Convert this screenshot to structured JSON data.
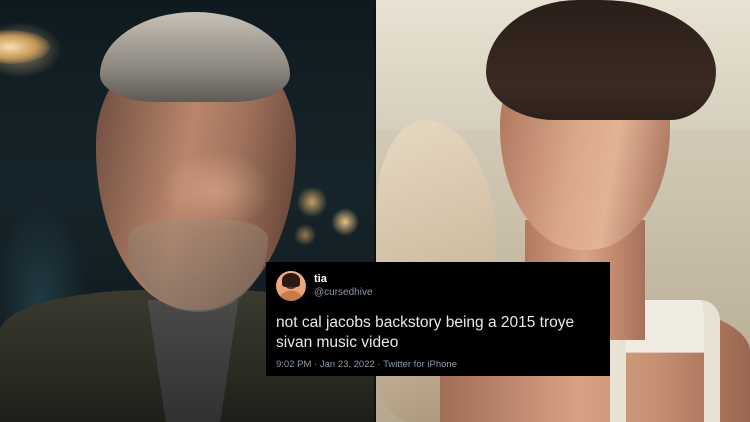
{
  "tweet": {
    "display_name": "tia",
    "handle": "@cursedhive",
    "text": "not cal jacobs backstory being a 2015 troye sivan music video",
    "time": "9:02 PM",
    "separator": "·",
    "date": "Jan 23, 2022",
    "source": "Twitter for iPhone",
    "avatar_icon": "profile-avatar-icon"
  },
  "colors": {
    "card_background": "#000000",
    "primary_text": "#e7e9ea",
    "secondary_text": "#8b98a5"
  }
}
